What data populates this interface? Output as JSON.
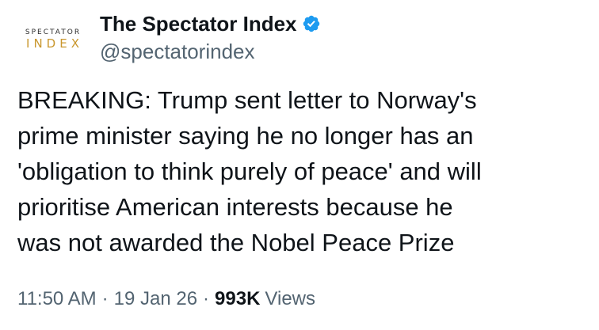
{
  "author": {
    "avatar_logo_top": "SPECTATOR",
    "avatar_logo_bottom": "INDEX",
    "display_name": "The Spectator Index",
    "handle": "@spectatorindex",
    "verified_icon": "verified-badge-icon",
    "verified_color": "#1d9bf0"
  },
  "tweet": {
    "text": "BREAKING: Trump sent letter to Norway's\nprime minister saying he no longer has an\n'obligation to think purely of peace' and will\nprioritise American interests because he\nwas not awarded the Nobel Peace Prize"
  },
  "meta": {
    "time": "11:50 AM",
    "separator": "·",
    "date": "19 Jan 26",
    "views_count": "993K",
    "views_label": "Views"
  }
}
